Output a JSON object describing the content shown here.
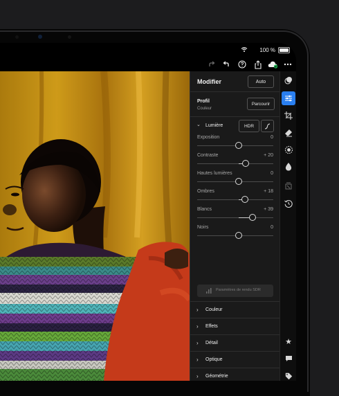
{
  "status": {
    "battery": "100 %"
  },
  "panel": {
    "title": "Modifier",
    "auto_label": "Auto",
    "profile_label": "Profil",
    "profile_value": "Couleur",
    "browse_label": "Parcourir",
    "light": {
      "title": "Lumière",
      "hdr_label": "HDR",
      "sliders": [
        {
          "name": "Exposition",
          "value": "0",
          "level": 0.0
        },
        {
          "name": "Contraste",
          "value": "+ 20",
          "level": 0.2
        },
        {
          "name": "Hautes lumières",
          "value": "0",
          "level": 0.0
        },
        {
          "name": "Ombres",
          "value": "+ 18",
          "level": 0.18
        },
        {
          "name": "Blancs",
          "value": "+ 39",
          "level": 0.39
        },
        {
          "name": "Noirs",
          "value": "0",
          "level": 0.0
        }
      ],
      "sdr_button": "Paramètres de rendu SDR"
    },
    "sections": [
      "Couleur",
      "Effets",
      "Détail",
      "Optique",
      "Géométrie"
    ]
  },
  "icons": {
    "toolbar": [
      "redo-icon",
      "undo-icon",
      "help-icon",
      "share-icon",
      "cloud-sync-icon",
      "more-icon"
    ],
    "rail": [
      "presets-icon",
      "edit-sliders-icon",
      "crop-icon",
      "healing-icon",
      "masking-icon",
      "remove-icon",
      "versions-icon",
      "history-icon",
      "star-icon",
      "comment-icon",
      "tag-icon"
    ]
  },
  "colors": {
    "accent": "#2a7ff0",
    "panel": "#1a1a1a",
    "background": "#1c1c1e"
  }
}
